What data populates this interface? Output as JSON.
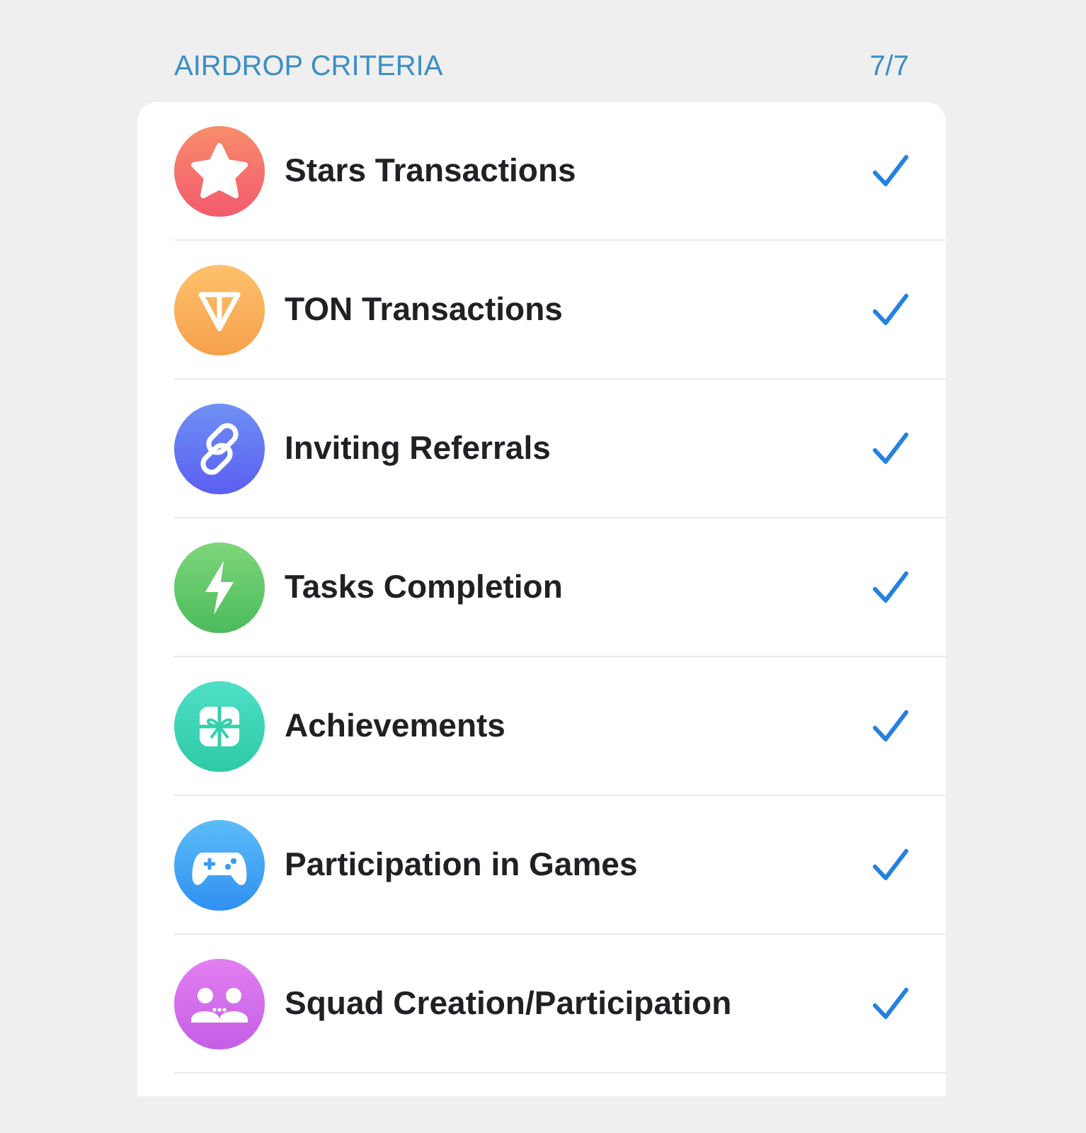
{
  "section": {
    "title": "AIRDROP CRITERIA",
    "count": "7/7"
  },
  "criteria": [
    {
      "label": "Stars Transactions",
      "checked": true
    },
    {
      "label": "TON Transactions",
      "checked": true
    },
    {
      "label": "Inviting Referrals",
      "checked": true
    },
    {
      "label": "Tasks Completion",
      "checked": true
    },
    {
      "label": "Achievements",
      "checked": true
    },
    {
      "label": "Participation in Games",
      "checked": true
    },
    {
      "label": "Squad Creation/Participation",
      "checked": true
    }
  ]
}
